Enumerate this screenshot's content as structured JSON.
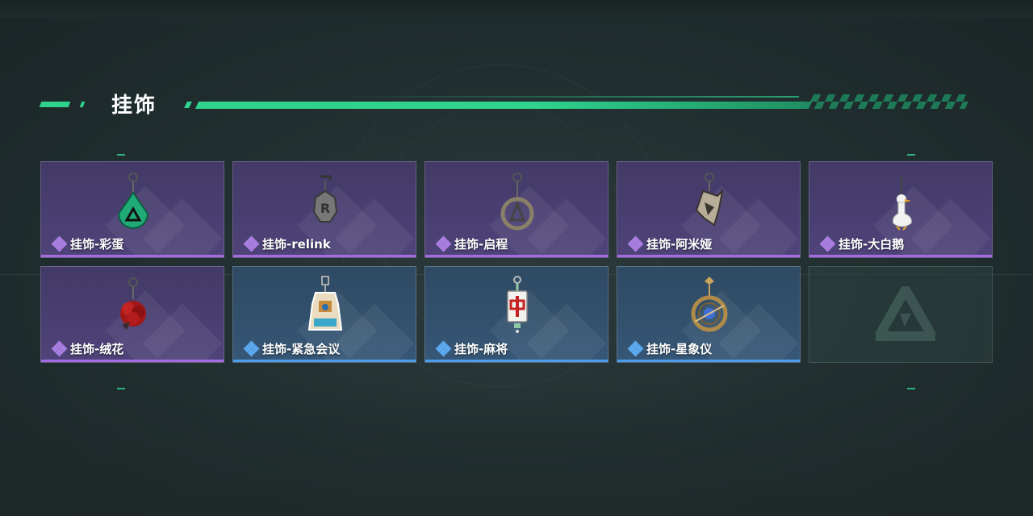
{
  "section": {
    "title": "挂饰"
  },
  "colors": {
    "accent": "#2fd38e",
    "rare_purple": "#a46ce0",
    "rare_blue": "#4d9ee8"
  },
  "items": [
    {
      "label": "挂饰-彩蛋",
      "rarity": "purple",
      "icon": "green-teardrop-charm-icon"
    },
    {
      "label": "挂饰-relink",
      "rarity": "purple",
      "icon": "r-badge-charm-icon"
    },
    {
      "label": "挂饰-启程",
      "rarity": "purple",
      "icon": "compass-ring-charm-icon"
    },
    {
      "label": "挂饰-阿米娅",
      "rarity": "purple",
      "icon": "plush-doll-charm-icon"
    },
    {
      "label": "挂饰-大白鹅",
      "rarity": "purple",
      "icon": "white-goose-charm-icon"
    },
    {
      "label": "挂饰-绒花",
      "rarity": "purple",
      "icon": "red-flower-charm-icon"
    },
    {
      "label": "挂饰-紧急会议",
      "rarity": "blue",
      "icon": "meeting-figure-charm-icon"
    },
    {
      "label": "挂饰-麻将",
      "rarity": "blue",
      "icon": "mahjong-tile-charm-icon"
    },
    {
      "label": "挂饰-星象仪",
      "rarity": "blue",
      "icon": "astrolabe-charm-icon"
    }
  ],
  "empty_slot": {
    "icon": "game-logo-icon"
  }
}
